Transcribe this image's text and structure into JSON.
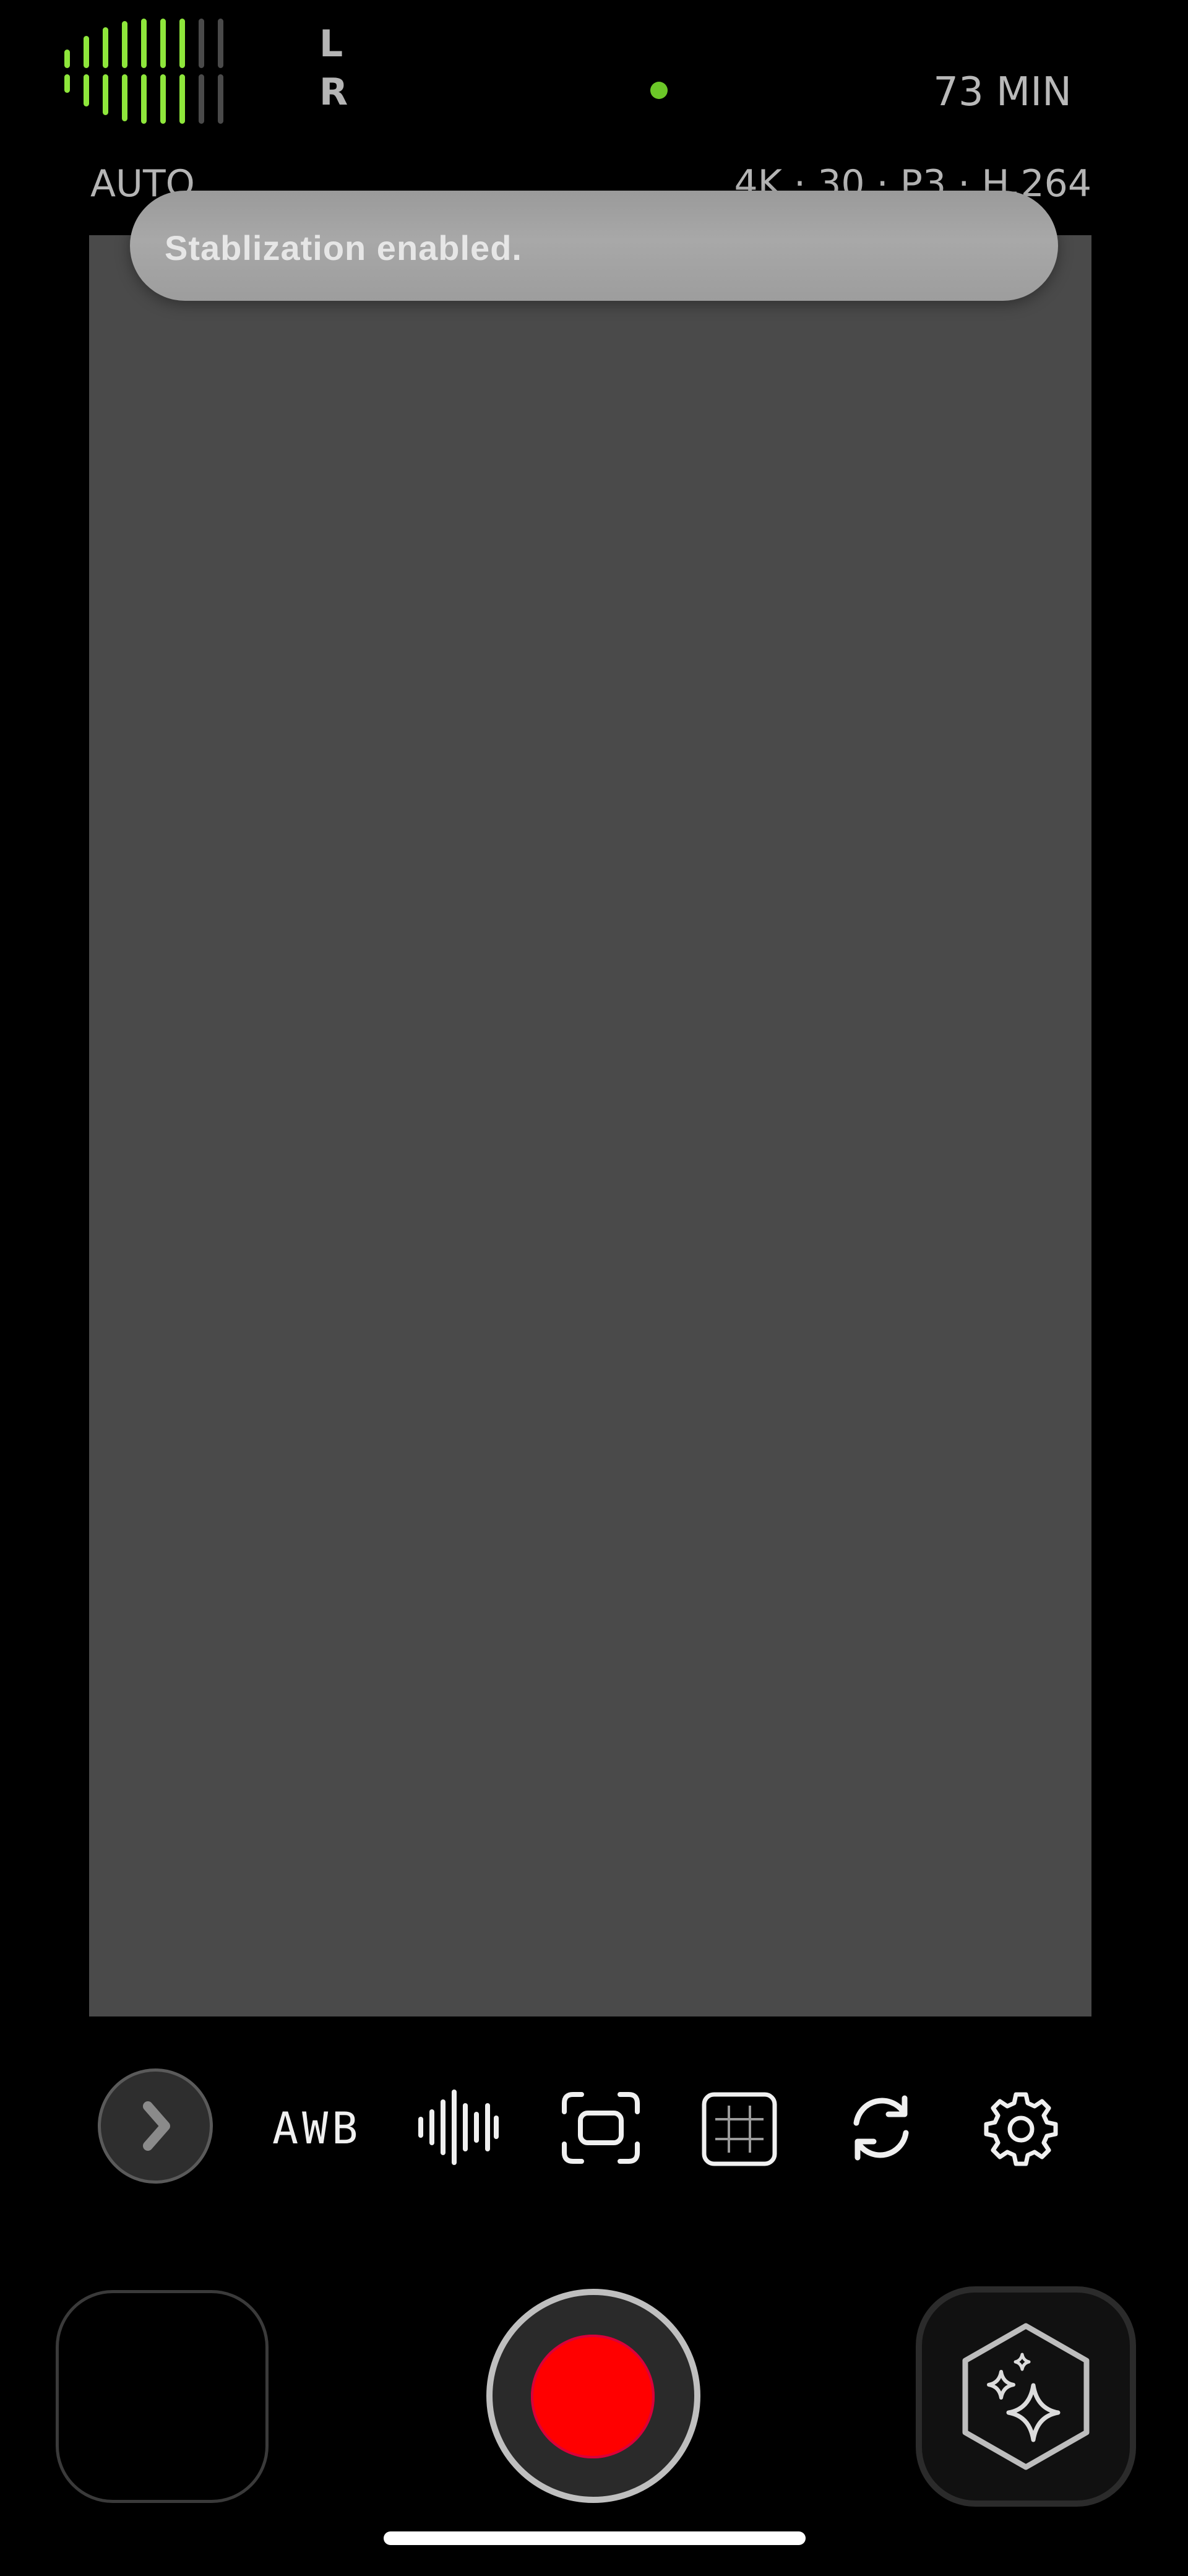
{
  "audio_meter": {
    "left_label": "L",
    "right_label": "R",
    "left_channel_level": 0.75,
    "right_channel_level": 0.75
  },
  "status": {
    "recording_time_remaining": "73 MIN",
    "exposure_mode": "AUTO",
    "video_format": "4K · 30 · P3 · H.264",
    "indicator_color": "#6cc728"
  },
  "toast": {
    "message": "Stablization enabled."
  },
  "toolbar": {
    "white_balance_label": "AWB",
    "icons": [
      "chevron-right-icon",
      "waveform-icon",
      "stabilization-icon",
      "grid-icon",
      "flip-camera-icon",
      "settings-gear-icon"
    ]
  },
  "bottom_bar": {
    "record_color": "#ff0000",
    "ai_icon": "sparkles-hexagon-icon"
  },
  "colors": {
    "meter_active": "#8ee63b",
    "viewfinder": "#4a4a4a",
    "background": "#000000"
  }
}
